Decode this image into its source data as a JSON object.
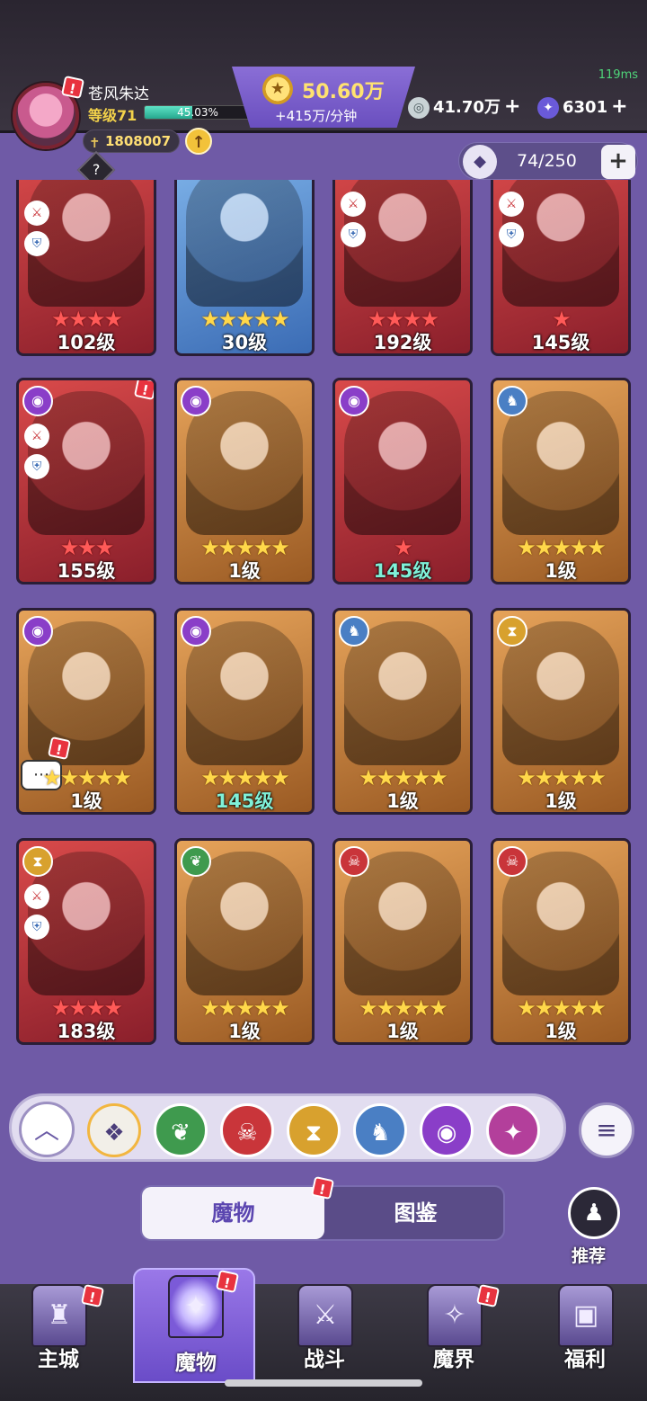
{
  "status": {
    "ping": "119ms"
  },
  "player": {
    "name": "苍风朱达",
    "level_label": "等级71",
    "xp_percent_text": "45.03%",
    "xp_fraction": 0.4503,
    "power": "1808007"
  },
  "resources": {
    "gold_amount": "50.60万",
    "gold_rate": "+415万/分钟",
    "silver": "41.70万",
    "gems": "6301"
  },
  "capacity": {
    "text": "74/250"
  },
  "monsters": [
    {
      "level": "102级",
      "stars": "★★★★",
      "star_color": "red",
      "frame": "red"
    },
    {
      "level": "30级",
      "stars": "★★★★★",
      "star_color": "gold",
      "frame": "blue"
    },
    {
      "level": "192级",
      "stars": "★★★★",
      "star_color": "red",
      "frame": "red"
    },
    {
      "level": "145级",
      "stars": "★",
      "star_color": "red",
      "frame": "red"
    },
    {
      "level": "155级",
      "stars": "★★★",
      "star_color": "red",
      "frame": "red"
    },
    {
      "level": "1级",
      "stars": "★★★★★",
      "star_color": "gold",
      "frame": "gold"
    },
    {
      "level": "145级",
      "stars": "★",
      "star_color": "red",
      "frame": "red"
    },
    {
      "level": "1级",
      "stars": "★★★★★",
      "star_color": "gold",
      "frame": "gold"
    },
    {
      "level": "1级",
      "stars": "★★★★★",
      "star_color": "gold",
      "frame": "gold"
    },
    {
      "level": "145级",
      "stars": "★★★★★",
      "star_color": "gold",
      "frame": "gold"
    },
    {
      "level": "1级",
      "stars": "★★★★★",
      "star_color": "gold",
      "frame": "gold"
    },
    {
      "level": "1级",
      "stars": "★★★★★",
      "star_color": "gold",
      "frame": "gold"
    },
    {
      "level": "183级",
      "stars": "★★★★",
      "star_color": "red",
      "frame": "red"
    },
    {
      "level": "1级",
      "stars": "★★★★★",
      "star_color": "gold",
      "frame": "gold"
    },
    {
      "level": "1级",
      "stars": "★★★★★",
      "star_color": "gold",
      "frame": "gold"
    },
    {
      "level": "1级",
      "stars": "★★★★★",
      "star_color": "gold",
      "frame": "gold"
    }
  ],
  "filters": [
    {
      "name": "all-elements-icon",
      "color": "#f2efe8",
      "glyph": "❖"
    },
    {
      "name": "nature-element-icon",
      "color": "#3f9a4e",
      "glyph": "❦"
    },
    {
      "name": "demon-element-icon",
      "color": "#c9353a",
      "glyph": "☠"
    },
    {
      "name": "hourglass-element-icon",
      "color": "#d8a12e",
      "glyph": "⧗"
    },
    {
      "name": "wolf-element-icon",
      "color": "#4a7fc4",
      "glyph": "♞"
    },
    {
      "name": "eye-element-icon",
      "color": "#8a3ec8",
      "glyph": "◉"
    },
    {
      "name": "arcane-element-icon",
      "color": "#b33f9b",
      "glyph": "✦"
    }
  ],
  "tabs": {
    "monsters": "魔物",
    "codex": "图鉴"
  },
  "recommend_label": "推荐",
  "nav": {
    "main_city": "主城",
    "monsters": "魔物",
    "battle": "战斗",
    "demon_realm": "魔界",
    "welfare": "福利"
  },
  "alert_mark": "!"
}
